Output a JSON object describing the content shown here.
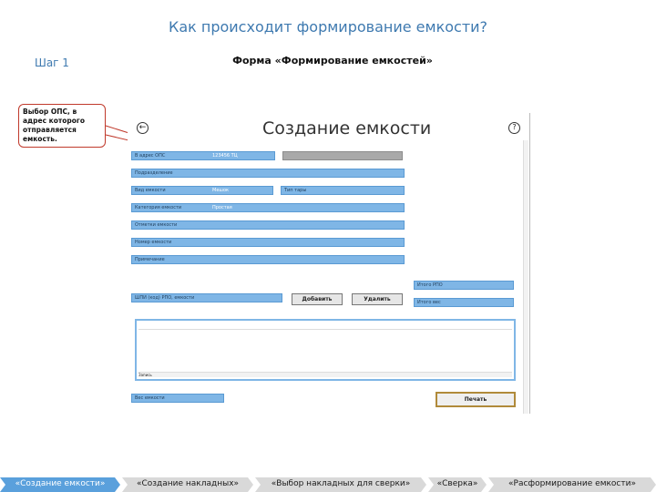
{
  "slide": {
    "title": "Как происходит формирование емкости?",
    "step": "Шаг 1",
    "form_caption": "Форма «Формирование емкостей»",
    "callout": "Выбор ОПС, в адрес которого отправляется емкость."
  },
  "window": {
    "title": "Создание емкости",
    "back_glyph": "←",
    "help_glyph": "?",
    "fields": {
      "ops_label": "В адрес ОПС",
      "ops_value": "123456 ТЦ",
      "div_label": "Подразделение",
      "div_value": "",
      "type_label": "Вид емкости",
      "type_value": "Мешок",
      "kind_label": "Тип тары",
      "kind_value": "",
      "cat_label": "Категория емкости",
      "cat_value": "Простая",
      "mark_label": "Отметки емкости",
      "mark_value": "",
      "place_label": "Номер емкости",
      "place_value": "",
      "note_label": "Примечание",
      "barcode_label": "ШПИ (код) РПО, емкости",
      "barcode_value": "",
      "total_label": "Итого РПО",
      "total_weight_label": "Итого вес",
      "total_count_label": "Вес емкости",
      "total_count_value": ""
    },
    "buttons": {
      "add": "Добавить",
      "delete": "Удалить",
      "print": "Печать"
    },
    "table": {
      "headers": [
        "",
        "",
        ""
      ],
      "rows": [
        [
          "",
          "",
          ""
        ]
      ],
      "footer": "Запись"
    }
  },
  "nav": [
    {
      "label": "«Создание емкости»",
      "active": true
    },
    {
      "label": "«Создание накладных»",
      "active": false
    },
    {
      "label": "«Выбор накладных для сверки»",
      "active": false
    },
    {
      "label": "«Сверка»",
      "active": false
    },
    {
      "label": "«Расформирование емкости»",
      "active": false
    }
  ]
}
